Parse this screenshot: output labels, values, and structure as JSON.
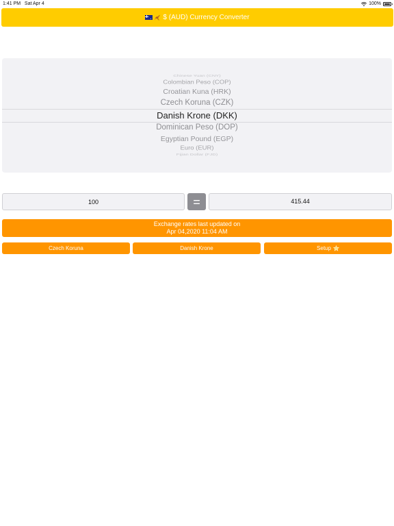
{
  "status_bar": {
    "time": "1:41 PM",
    "date": "Sat Apr 4",
    "battery": "100%"
  },
  "header": {
    "title": "$ (AUD) Currency Converter",
    "icons": [
      "australia-flag-icon",
      "kangaroo-icon"
    ]
  },
  "picker": {
    "items": [
      "Chinese Yuan (CNY)",
      "Colombian Peso (COP)",
      "Croatian Kuna (HRK)",
      "Czech Koruna (CZK)",
      "Danish Krone (DKK)",
      "Dominican Peso (DOP)",
      "Egyptian Pound (EGP)",
      "Euro (EUR)",
      "Fijian Dollar (FJD)"
    ],
    "selected": "Danish Krone (DKK)"
  },
  "converter": {
    "amount": "100",
    "equals_label": "=",
    "result": "415.44"
  },
  "update_banner": {
    "line1": "Exchange rates last updated on",
    "line2": "Apr 04,2020 11:04 AM"
  },
  "buttons": {
    "from_currency": "Czech Koruna",
    "to_currency": "Danish Krone",
    "setup": "Setup"
  },
  "colors": {
    "header": "#ffcc00",
    "accent": "#ff9500",
    "equals": "#8e8e93",
    "field_bg": "#f2f2f5"
  }
}
